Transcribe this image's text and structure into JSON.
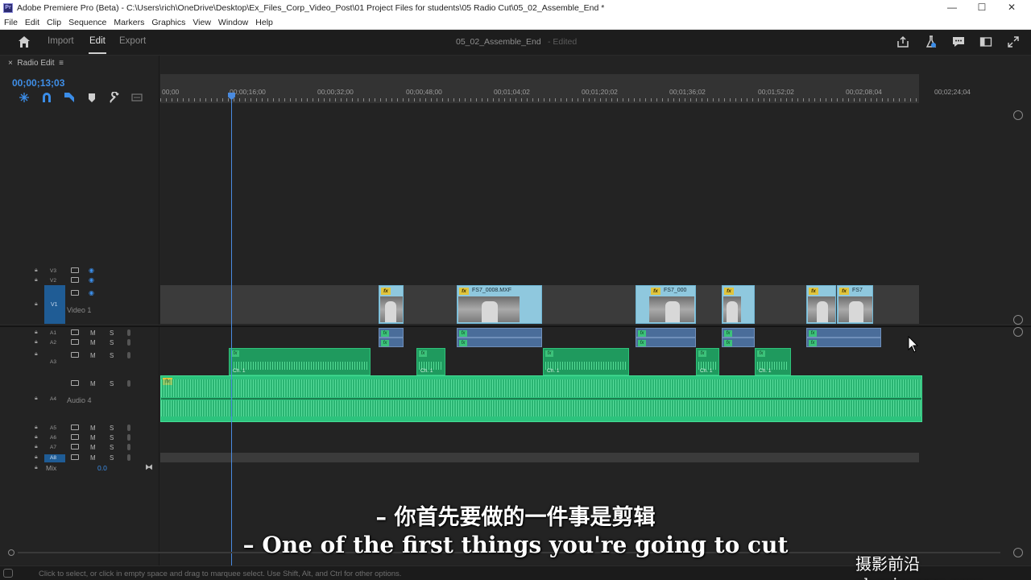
{
  "window": {
    "title": "Adobe Premiere Pro (Beta) - C:\\Users\\rich\\OneDrive\\Desktop\\Ex_Files_Corp_Video_Post\\01 Project Files for students\\05 Radio Cut\\05_02_Assemble_End *",
    "minimize": "—",
    "maximize": "☐",
    "close": "✕"
  },
  "menu": [
    "File",
    "Edit",
    "Clip",
    "Sequence",
    "Markers",
    "Graphics",
    "View",
    "Window",
    "Help"
  ],
  "header": {
    "tabs": [
      "Import",
      "Edit",
      "Export"
    ],
    "active_tab": "Edit",
    "document": "05_02_Assemble_End",
    "status": "- Edited"
  },
  "timeline": {
    "panel_close": "×",
    "panel_name": "Radio Edit",
    "panel_menu": "≡",
    "timecode": "00;00;13;03",
    "ruler_ticks": [
      "00;00",
      "00;00;16;00",
      "00;00;32;00",
      "00;00;48;00",
      "00;01;04;02",
      "00;01;20;02",
      "00;01;36;02",
      "00;01;52;02",
      "00;02;08;04",
      "00;02;24;04"
    ],
    "video_tracks": [
      "V3",
      "V2",
      "V1"
    ],
    "v1_name": "Video 1",
    "audio_tracks": [
      "A1",
      "A2",
      "A3",
      "A4",
      "A5",
      "A6",
      "A7",
      "A8"
    ],
    "a4_name": "Audio 4",
    "mix_label": "Mix",
    "mix_value": "0.0",
    "mute_label": "M",
    "solo_label": "S",
    "fx_badge": "fx",
    "clip_names": [
      "FS7_0008.MXF",
      "FS7_000",
      "FS7"
    ],
    "channel_label": "Ch. 1"
  },
  "status_text": "Click to select, or click in empty space and drag to marquee select. Use Shift, Alt, and Ctrl for other options.",
  "subtitles": {
    "chinese": "– 你首先要做的一件事是剪辑",
    "english": "– One of the first things you're going to cut"
  },
  "watermark": "摄影前沿 sheyingzyz.com",
  "colors": {
    "accent_blue": "#3b8de8",
    "audio_green": "#2cc37d",
    "video_clip": "#8fc8de",
    "fx_yellow": "#e0c43c"
  }
}
